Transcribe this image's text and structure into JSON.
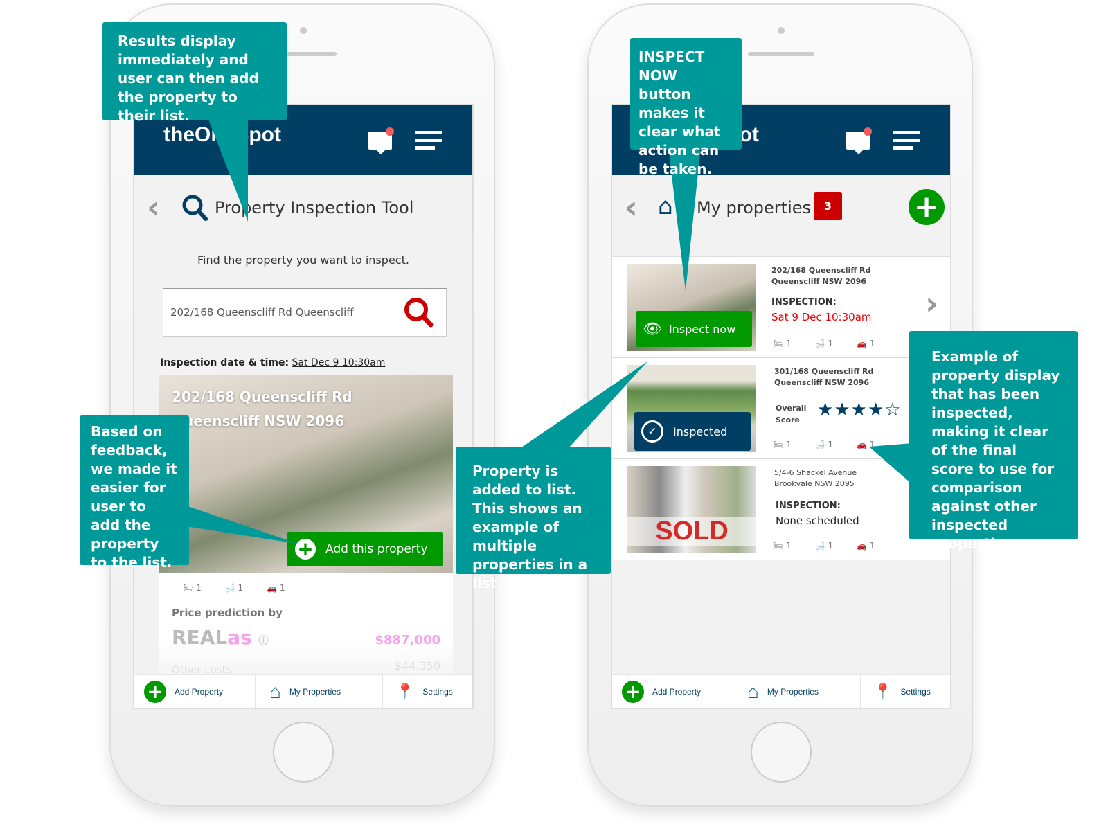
{
  "left_phone": {
    "logo": "theOneSpot",
    "title": "Property Inspection Tool",
    "subtitle": "Find the property you want to inspect.",
    "search": {
      "value": "202/168 Queenscliff Rd Queenscliff"
    },
    "inspection_label": "Inspection date & time:",
    "inspection_value": "Sat Dec 9 10:30am",
    "property": {
      "line1": "202/168 Queenscliff Rd",
      "line2": "Queenscliff NSW 2096",
      "beds": "1",
      "baths": "1",
      "cars": "1"
    },
    "add_button": "Add this property",
    "price_label": "Price prediction by",
    "realas": {
      "a": "REAL",
      "b": "as"
    },
    "price": "$887,000",
    "other_costs_label": "Other costs",
    "other_costs": "$44,350"
  },
  "right_phone": {
    "logo": "theOneSpot",
    "title": "My properties",
    "count_badge": "3",
    "properties": [
      {
        "line1": "202/168 Queenscliff Rd",
        "line2": "Queenscliff NSW 2096",
        "label": "INSPECTION:",
        "value": "Sat 9 Dec 10:30am",
        "button": "Inspect now",
        "beds": "1",
        "baths": "1",
        "cars": "1"
      },
      {
        "line1": "301/168 Queenscliff Rd",
        "line2": "Queenscliff NSW 2096",
        "score_label_1": "Overall",
        "score_label_2": "Score",
        "stars": 4,
        "stars_max": 5,
        "badge": "Inspected",
        "beds": "1",
        "baths": "1",
        "cars": "1"
      },
      {
        "line1": "5/4-6 Shackel Avenue",
        "line2": "Brookvale NSW 2095",
        "label": "INSPECTION:",
        "value": "None scheduled",
        "overlay": "SOLD",
        "beds": "1",
        "baths": "1",
        "cars": "1"
      }
    ]
  },
  "footer": {
    "add": "Add Property",
    "mine": "My Properties",
    "settings": "Settings"
  },
  "callouts": {
    "c1": "Results display immediately and user can then add the property to their list.",
    "c2": "Based on feedback, we made it easier for user to add the property to the list.",
    "c3": "Property is added to list. This shows an example of multiple properties in a list.",
    "c4": "INSPECT NOW button makes it clear what action can be taken.",
    "c5": "Example of property display that has been inspected, making it clear of the final score to use for comparison against other inspected properties."
  },
  "colors": {
    "navy": "#003f63",
    "teal": "#009999",
    "green": "#009900",
    "red": "#cc0000"
  }
}
